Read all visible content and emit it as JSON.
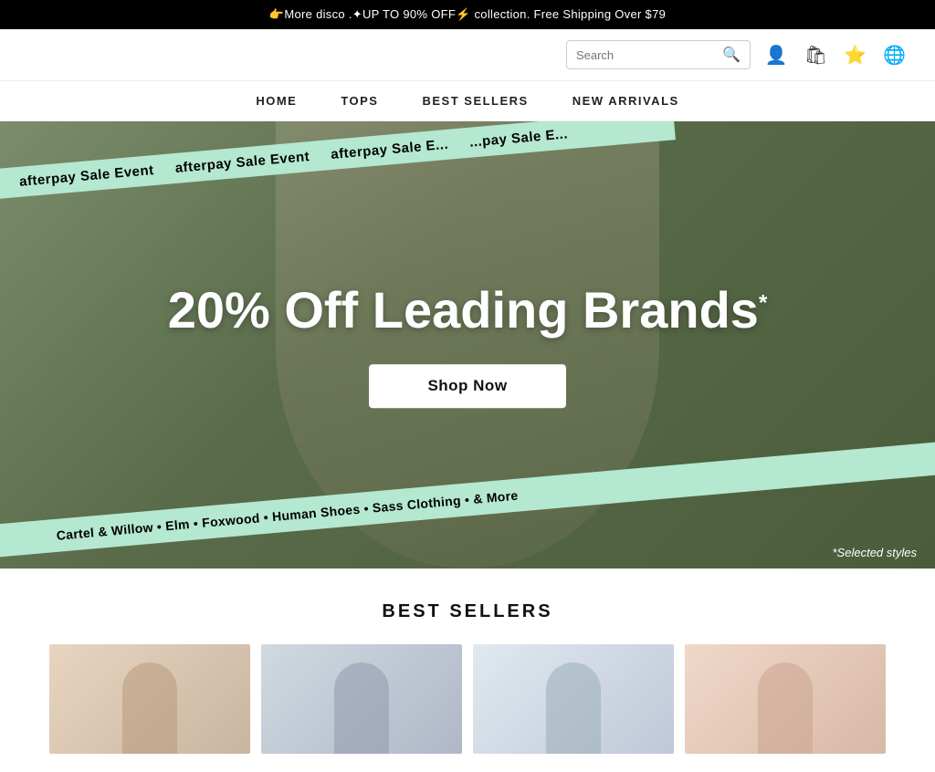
{
  "announcement": {
    "text": "👉More disco .✦UP TO 90% OFF⚡ collection.  Free Shipping Over $79"
  },
  "header": {
    "logo": "",
    "search_placeholder": "Search",
    "icons": [
      "search",
      "user",
      "bag",
      "wishlist",
      "globe"
    ]
  },
  "nav": {
    "items": [
      "HOME",
      "TOPS",
      "BEST SELLERS",
      "NEW ARRIVALS"
    ]
  },
  "hero": {
    "afterpay_top": "afterpay Sale Event   afterpay Sale Event   afterpay Sale E...   ...pay Sale E...",
    "headline": "20% Off Leading Brands",
    "asterisk": "*",
    "cta_label": "Shop Now",
    "brands_text": "Cartel & Willow • Elm • Foxwood • Human Shoes • Sass Clothing • & More",
    "selected_styles": "*Selected styles"
  },
  "best_sellers": {
    "title": "BEST SELLERS",
    "products": [
      {
        "id": 1,
        "alt": "Product 1"
      },
      {
        "id": 2,
        "alt": "Product 2"
      },
      {
        "id": 3,
        "alt": "Product 3"
      },
      {
        "id": 4,
        "alt": "Product 4"
      }
    ]
  }
}
